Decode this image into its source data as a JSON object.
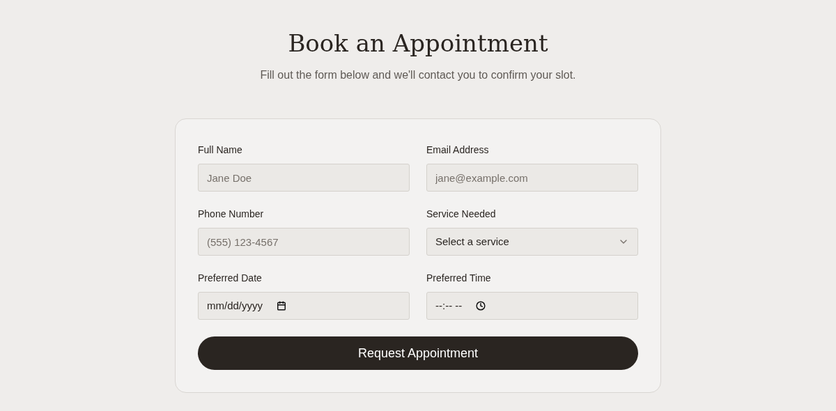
{
  "title": "Book an Appointment",
  "subtitle": "Fill out the form below and we'll contact you to confirm your slot.",
  "fields": [
    {
      "label": "Full Name",
      "kind": "text",
      "placeholder": "Jane Doe"
    },
    {
      "label": "Email Address",
      "kind": "text",
      "placeholder": "jane@example.com"
    },
    {
      "label": "Phone Number",
      "kind": "text",
      "placeholder": "(555) 123-4567"
    },
    {
      "label": "Service Needed",
      "kind": "select",
      "value": "Select a service"
    },
    {
      "label": "Preferred Date",
      "kind": "date",
      "value": "mm/dd/yyyy"
    },
    {
      "label": "Preferred Time",
      "kind": "time",
      "value": "--:-- --"
    }
  ],
  "submit": "Request Appointment"
}
